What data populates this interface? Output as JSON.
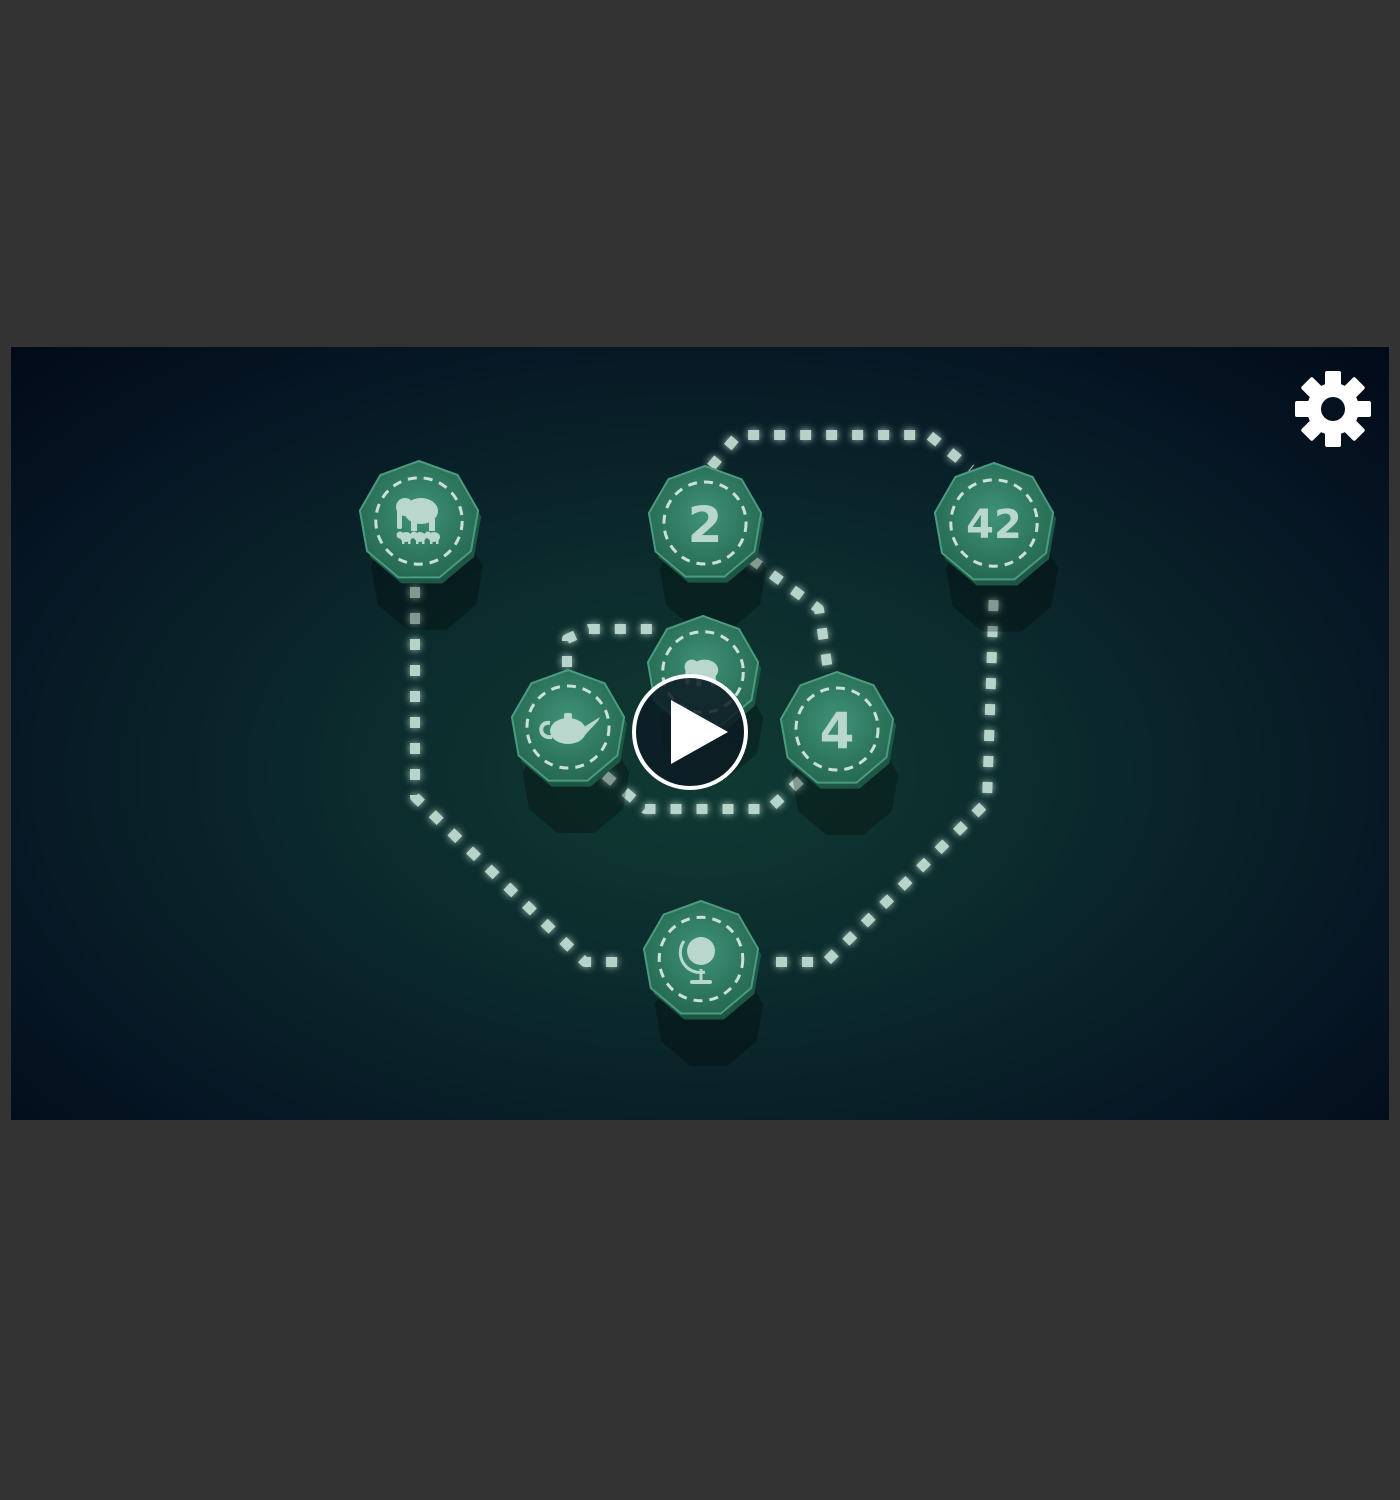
{
  "window": {
    "background": "#333333"
  },
  "game": {
    "background_center": "#103a33",
    "background_edge": "#020a18",
    "path_color": "#c9e6da",
    "node_fill": "#2f7a63",
    "node_rim": "#4a9b80",
    "levels": [
      {
        "id": "elephants",
        "icon": "elephant-family-icon",
        "label": ""
      },
      {
        "id": "two",
        "icon": "number-two-icon",
        "label": "2"
      },
      {
        "id": "forty-two",
        "icon": "number-forty-two-icon",
        "label": "42"
      },
      {
        "id": "elephant",
        "icon": "elephant-icon",
        "label": ""
      },
      {
        "id": "teapot",
        "icon": "teapot-icon",
        "label": ""
      },
      {
        "id": "four",
        "icon": "number-four-icon",
        "label": "4"
      },
      {
        "id": "globe",
        "icon": "globe-icon",
        "label": ""
      }
    ],
    "play_button": {
      "icon": "play-icon"
    },
    "settings_button": {
      "icon": "gear-icon"
    }
  }
}
